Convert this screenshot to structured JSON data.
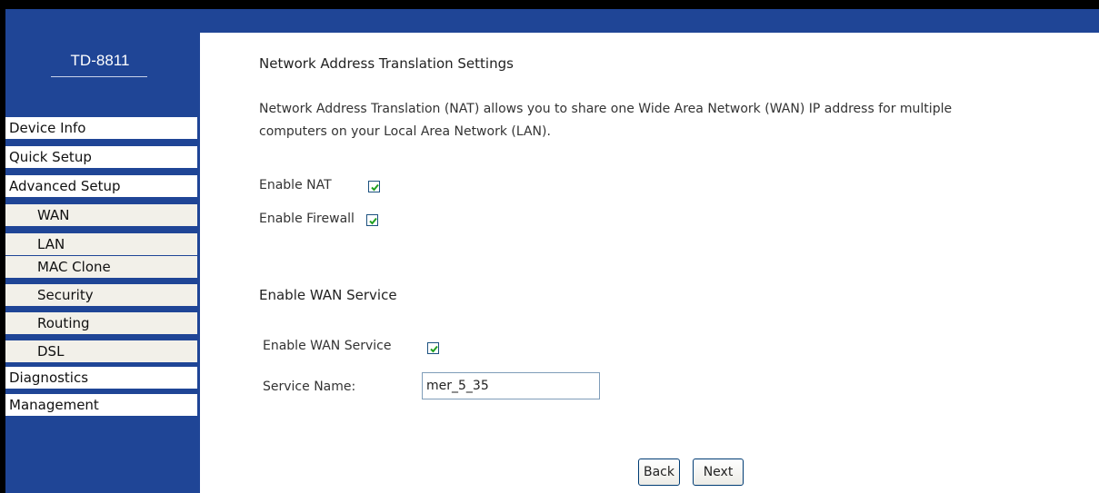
{
  "sidebar": {
    "model": "TD-8811",
    "items": [
      {
        "label": "Device Info"
      },
      {
        "label": "Quick Setup"
      },
      {
        "label": "Advanced Setup"
      },
      {
        "label": "WAN"
      },
      {
        "label": "LAN"
      },
      {
        "label": "MAC Clone"
      },
      {
        "label": "Security"
      },
      {
        "label": "Routing"
      },
      {
        "label": "DSL"
      },
      {
        "label": "Diagnostics"
      },
      {
        "label": "Management"
      }
    ]
  },
  "nat": {
    "title": "Network Address Translation Settings",
    "description_line1": "Network Address Translation (NAT) allows you to share one Wide Area Network (WAN) IP address for multiple",
    "description_line2": "computers on your Local Area Network (LAN).",
    "enable_nat_label": "Enable NAT",
    "enable_nat_checked": true,
    "enable_firewall_label": "Enable Firewall",
    "enable_firewall_checked": true
  },
  "wan_service": {
    "title": "Enable WAN Service",
    "enable_label": "Enable WAN Service",
    "enable_checked": true,
    "service_name_label": "Service Name:",
    "service_name_value": "mer_5_35"
  },
  "buttons": {
    "back": "Back",
    "next": "Next"
  },
  "colors": {
    "sidebar_bg": "#1f4596",
    "checkmark": "#21a121"
  }
}
